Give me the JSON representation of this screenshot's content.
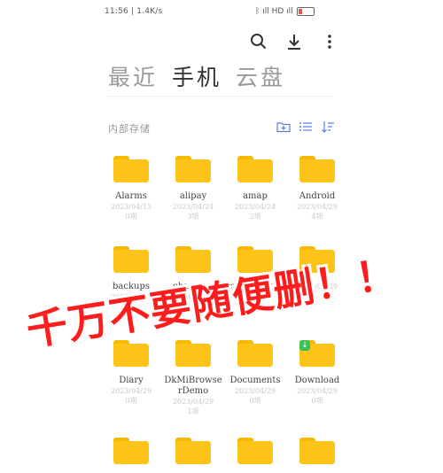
{
  "status_bar": {
    "left_text": "11:56 | 1.4K/s",
    "right_text": "ᛒ ıll HD ıll ",
    "battery_label": "",
    "battery_level": 0.25,
    "battery_color": "#e25b4a"
  },
  "toolbar": {
    "search_icon": "search-icon",
    "download_icon": "download-icon",
    "more_icon": "more-vertical-icon"
  },
  "tabs": [
    {
      "label": "最近",
      "active": false
    },
    {
      "label": "手机",
      "active": true
    },
    {
      "label": "云盘",
      "active": false
    }
  ],
  "section": {
    "label": "内部存储"
  },
  "files": [
    {
      "name": "Alarms",
      "meta1": "2023/04/13",
      "meta2": "0项"
    },
    {
      "name": "alipay",
      "meta1": "2023/04/24",
      "meta2": "3项"
    },
    {
      "name": "amap",
      "meta1": "2023/04/24",
      "meta2": "2项"
    },
    {
      "name": "Android",
      "meta1": "2023/04/29",
      "meta2": "4项"
    },
    {
      "name": "backups",
      "meta1": "2023/04/29",
      "meta2": "0项"
    },
    {
      "name": "chaoxing",
      "meta1": "2023/04/29",
      "meta2": "1项"
    },
    {
      "name": "com.quark.br",
      "meta1": "owser",
      "meta2": ""
    },
    {
      "name": "",
      "meta1": "2023/04/29",
      "meta2": ""
    },
    {
      "name": "Diary",
      "meta1": "2023/04/29",
      "meta2": "0项"
    },
    {
      "name": "DkMiBrowse",
      "name2": "rDemo",
      "meta1": "2023/04/29",
      "meta2": "1项"
    },
    {
      "name": "Documents",
      "meta1": "2023/04/29",
      "meta2": "0项"
    },
    {
      "name": "Download",
      "meta1": "2023/04/29",
      "meta2": "0项",
      "badge": true
    },
    {
      "name": "",
      "meta1": "",
      "meta2": ""
    },
    {
      "name": "",
      "meta1": "",
      "meta2": ""
    },
    {
      "name": "",
      "meta1": "",
      "meta2": ""
    },
    {
      "name": "",
      "meta1": "",
      "meta2": ""
    }
  ],
  "overlay_text": "千万不要随便删！！",
  "colors": {
    "folder": "#fcc419",
    "folder_tab": "#f7b900",
    "badge": "#3cc15a",
    "overlay": "#ff1c1c"
  }
}
